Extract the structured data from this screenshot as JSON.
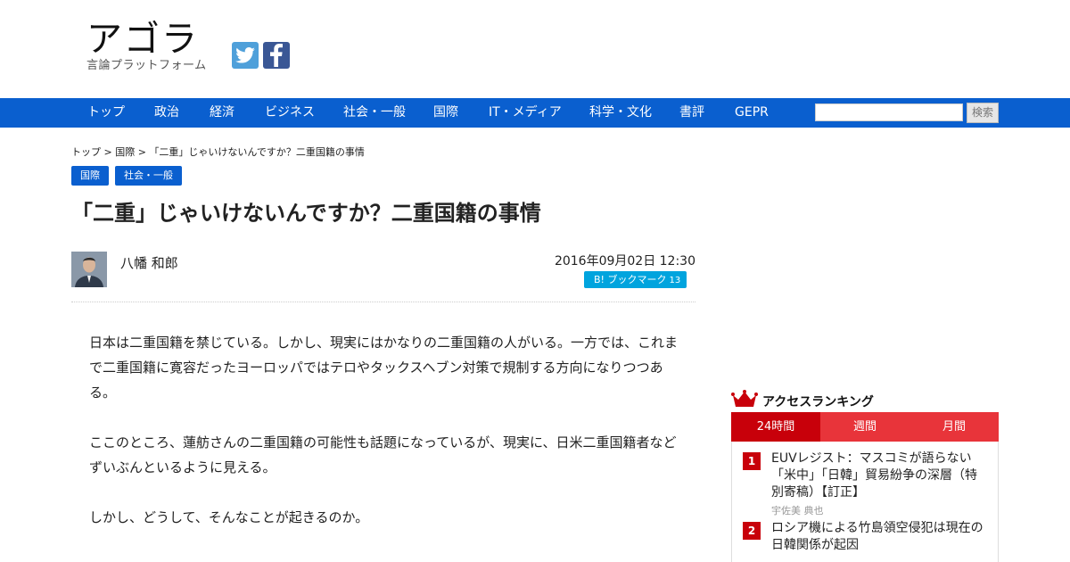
{
  "site": {
    "logo": "アゴラ",
    "tagline": "言論プラットフォーム"
  },
  "social": {
    "twitter_icon": "twitter-icon",
    "facebook_icon": "facebook-icon"
  },
  "nav": {
    "items": [
      "トップ",
      "政治",
      "経済",
      "ビジネス",
      "社会・一般",
      "国際",
      "IT・メディア",
      "科学・文化",
      "書評",
      "GEPR"
    ],
    "search_button": "検索",
    "color": "#0a5fcf"
  },
  "breadcrumb": "トップ > 国際 > 「二重」じゃいけないんですか？二重国籍の事情",
  "article": {
    "tags": [
      "国際",
      "社会・一般"
    ],
    "title": "「二重」じゃいけないんですか？二重国籍の事情",
    "author": "八幡 和郎",
    "date": "2016年09月02日 12:30",
    "bookmark": {
      "label": "B! ブックマーク",
      "count": "13"
    },
    "paragraphs": [
      "日本は二重国籍を禁じている。しかし、現実にはかなりの二重国籍の人がいる。一方では、これまで二重国籍に寛容だったヨーロッパではテロやタックスヘブン対策で規制する方向になりつつある。",
      "ここのところ、蓮舫さんの二重国籍の可能性も話題になっているが、現実に、日米二重国籍者などずいぶんといるように見える。",
      "しかし、どうして、そんなことが起きるのか。"
    ]
  },
  "ranking": {
    "title": "アクセスランキング",
    "tabs": [
      "24時間",
      "週間",
      "月間"
    ],
    "active_tab": "24時間",
    "items": [
      {
        "rank": "1",
        "title": "EUVレジスト：マスコミが語らない「米中」「日韓」貿易紛争の深層（特別寄稿）【訂正】",
        "author": "宇佐美 典也"
      },
      {
        "rank": "2",
        "title": "ロシア機による竹島領空侵犯は現在の日韓関係が起因",
        "author": ""
      }
    ],
    "accent": "#c8000a"
  }
}
